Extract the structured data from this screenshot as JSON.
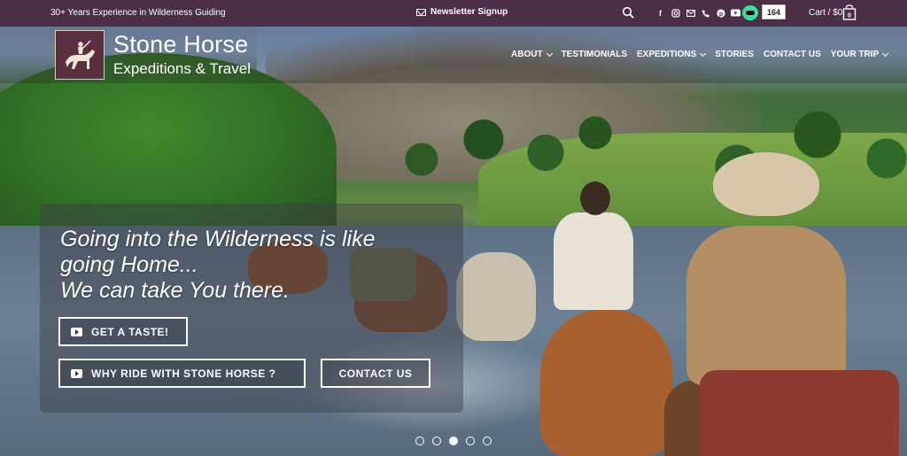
{
  "topbar": {
    "tagline": "30+ Years Experience in Wilderness Guiding",
    "newsletter": "Newsletter Signup",
    "tripadvisor_count": "164",
    "cart": "Cart / $0",
    "cart_count": "0",
    "social_icons": [
      "facebook-icon",
      "instagram-icon",
      "email-icon",
      "phone-icon",
      "pinterest-icon",
      "youtube-icon"
    ]
  },
  "brand": {
    "title": "Stone Horse",
    "subtitle": "Expeditions & Travel"
  },
  "nav": {
    "items": [
      {
        "label": "About",
        "dropdown": true
      },
      {
        "label": "Testimonials",
        "dropdown": false
      },
      {
        "label": "Expeditions",
        "dropdown": true
      },
      {
        "label": "Stories",
        "dropdown": false
      },
      {
        "label": "Contact Us",
        "dropdown": false
      },
      {
        "label": "Your Trip",
        "dropdown": true
      }
    ]
  },
  "hero": {
    "line1": "Going into the Wilderness is like",
    "line2": "going Home...",
    "line3": "We can take You there.",
    "buttons": {
      "taste": "GET A TASTE!",
      "why": "WHY RIDE WITH STONE HORSE ?",
      "contact": "CONTACT US"
    }
  },
  "slider": {
    "total": 5,
    "active": 3
  },
  "colors": {
    "topbar_bg": "#4a2f47",
    "logo_bg": "#5a2f3f",
    "tripadvisor": "#34e0a1"
  }
}
